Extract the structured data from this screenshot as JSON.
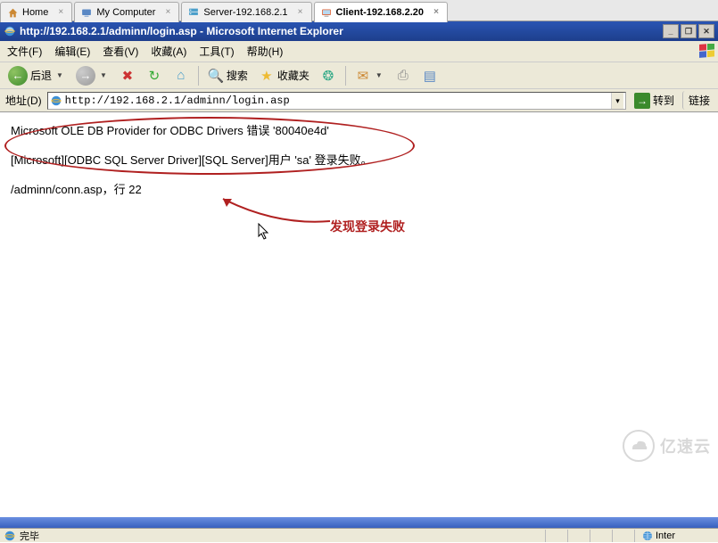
{
  "vm_tabs": [
    {
      "label": "Home",
      "icon": "home"
    },
    {
      "label": "My Computer",
      "icon": "computer"
    },
    {
      "label": "Server-192.168.2.1",
      "icon": "server"
    },
    {
      "label": "Client-192.168.2.20",
      "icon": "client",
      "active": true
    }
  ],
  "titlebar_text": "http://192.168.2.1/adminn/login.asp - Microsoft Internet Explorer",
  "menu": {
    "file": "文件(F)",
    "edit": "编辑(E)",
    "view": "查看(V)",
    "favorites": "收藏(A)",
    "tools": "工具(T)",
    "help": "帮助(H)"
  },
  "toolbar": {
    "back": "后退",
    "search": "搜索",
    "favorites": "收藏夹"
  },
  "addressbar": {
    "label": "地址(D)",
    "url": "http://192.168.2.1/adminn/login.asp",
    "go": "转到",
    "links": "链接"
  },
  "error": {
    "line1": "Microsoft OLE DB Provider for ODBC Drivers 错误 '80040e4d'",
    "line2": "[Microsoft][ODBC SQL Server Driver][SQL Server]用户 'sa' 登录失败。",
    "line3": "/adminn/conn.asp，行 22"
  },
  "annotation": "发现登录失败",
  "statusbar": {
    "done": "完毕",
    "zone": "Inter"
  },
  "watermark": "亿速云"
}
